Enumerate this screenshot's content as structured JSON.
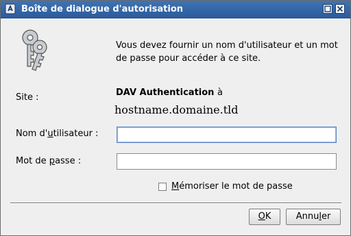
{
  "window": {
    "title": "Boîte de dialogue d'autorisation",
    "icons": {
      "app": "app-icon",
      "maximize": "maximize-icon",
      "close": "close-icon"
    }
  },
  "dialog": {
    "icon": "keys-icon",
    "message": "Vous devez fournir un nom d'utilisateur et un mot de passe pour accéder à ce site.",
    "site": {
      "label": "Site :",
      "name": "DAV Authentication",
      "connector": "à",
      "host": "hostname.domaine.tld"
    },
    "username": {
      "label_prefix": "Nom d'",
      "label_mnemonic": "u",
      "label_suffix": "tilisateur :",
      "value": ""
    },
    "password": {
      "label_prefix": "Mot de ",
      "label_mnemonic": "p",
      "label_suffix": "asse :",
      "value": ""
    },
    "remember": {
      "label_mnemonic": "M",
      "label_rest": "émoriser le mot de passe",
      "checked": false
    }
  },
  "buttons": {
    "ok": {
      "mnemonic": "O",
      "rest": "K"
    },
    "cancel": {
      "before": "Annu",
      "mnemonic": "l",
      "after": "er"
    }
  },
  "colors": {
    "titlebar": "#2f63a6",
    "background": "#efefef",
    "focus": "#5d87c6"
  }
}
